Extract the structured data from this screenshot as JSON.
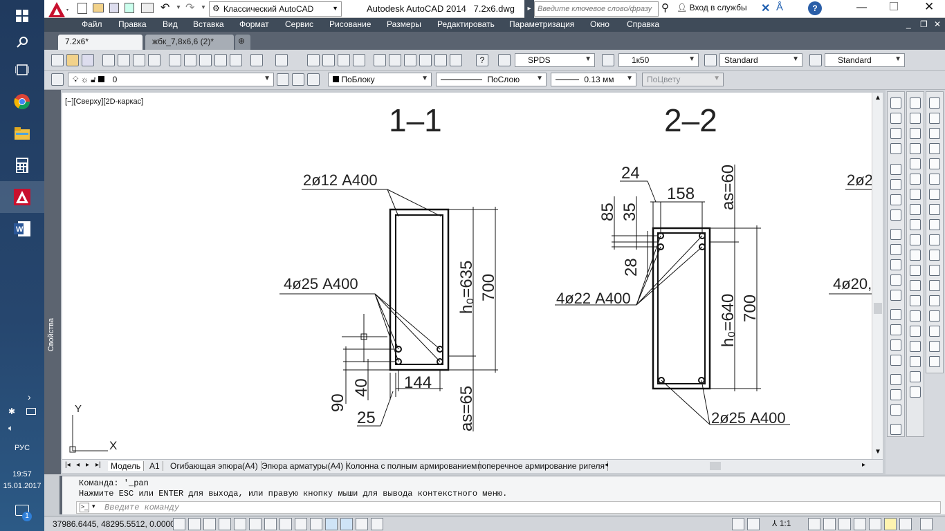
{
  "taskbar": {
    "language": "РУС",
    "time": "19:57",
    "date": "15.01.2017",
    "notification_count": "1"
  },
  "title": {
    "workspace": "Классический AutoCAD",
    "app_title": "Autodesk AutoCAD 2014",
    "file": "7.2x6.dwg",
    "search_placeholder": "Введите ключевое слово/фразу",
    "signin": "Вход в службы"
  },
  "menu": {
    "items": [
      "Файл",
      "Правка",
      "Вид",
      "Вставка",
      "Формат",
      "Сервис",
      "Рисование",
      "Размеры",
      "Редактировать",
      "Параметризация",
      "Окно",
      "Справка"
    ]
  },
  "tabs": {
    "items": [
      "7.2x6*",
      "жбк_7,8x6,6 (2)*"
    ]
  },
  "toolbar": {
    "text_style": "SPDS",
    "dim_style": "1к50",
    "table_style": "Standard",
    "mleader_style": "Standard",
    "layer": "0",
    "color": "ПоБлоку",
    "linetype": "ПоСлою",
    "lineweight": "0.13 мм",
    "plotstyle": "ПоЦвету"
  },
  "viewport": {
    "label": "[−][Сверху][2D-каркас]",
    "side_palette_label": "Свойства"
  },
  "drawing": {
    "section1": {
      "title": "1–1",
      "top_rebar": "2ø12 А400",
      "bottom_rebar": "4ø25 А400",
      "h0": "h₀=635",
      "height": "700",
      "width_dim": "144",
      "dim_90": "90",
      "dim_40": "40",
      "dim_25": "25",
      "as": "as=65"
    },
    "section2": {
      "title": "2–2",
      "top_rebar": "4ø22 А400",
      "bottom_rebar": "2ø25 А400",
      "dim_24": "24",
      "dim_158": "158",
      "dim_85": "85",
      "dim_35": "35",
      "dim_28": "28",
      "as": "as=60",
      "h0": "h₀=640",
      "height": "700"
    },
    "section3_partial": {
      "top": "2ø2",
      "mid": "4ø20,"
    },
    "ucs": {
      "x": "X",
      "y": "Y"
    }
  },
  "layouts": {
    "items": [
      "Модель",
      "А1",
      "Огибающая эпюра(А4)",
      "Эпюра арматуры(А4)",
      "Колонна с полным армированием",
      "поперечное армирование ригеля"
    ]
  },
  "command": {
    "line1": "Команда:  '_pan",
    "line2": "Нажмите ESC или ENTER для выхода, или правую кнопку мыши для вывода контекстного меню.",
    "placeholder": "Введите команду"
  },
  "status": {
    "coords": "37986.6445, 48295.5512, 0.0000",
    "scale": "1:1"
  }
}
